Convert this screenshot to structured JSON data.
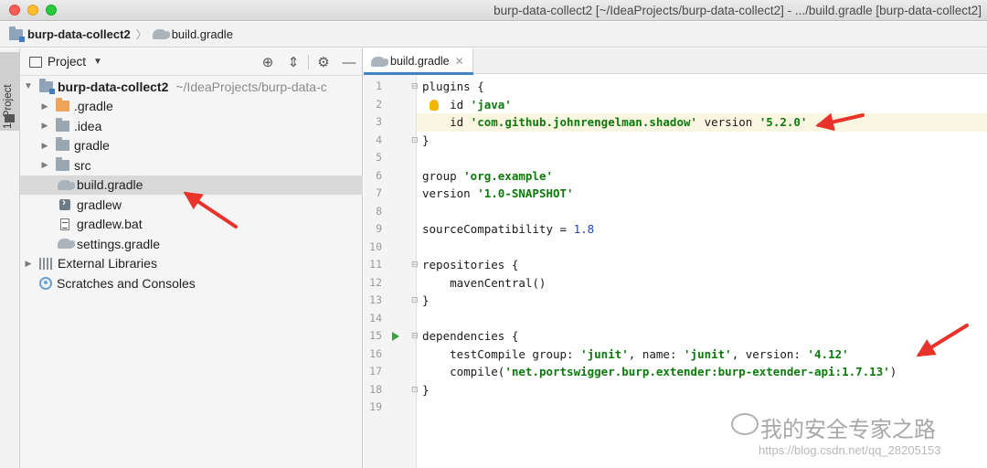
{
  "window": {
    "title": "burp-data-collect2 [~/IdeaProjects/burp-data-collect2] - .../build.gradle [burp-data-collect2]"
  },
  "breadcrumb": {
    "project": "burp-data-collect2",
    "file": "build.gradle"
  },
  "toolstrip": {
    "label": "1: Project"
  },
  "project_panel": {
    "title": "Project",
    "tools": [
      "locate-icon",
      "collapse-icon",
      "gear-icon",
      "hide-icon"
    ],
    "tree": [
      {
        "label": "burp-data-collect2",
        "path": "~/IdeaProjects/burp-data-c",
        "icon": "module-folder-icon",
        "expanded": true
      },
      {
        "label": ".gradle",
        "icon": "folder-orange-icon",
        "expanded": false
      },
      {
        "label": ".idea",
        "icon": "folder-icon",
        "expanded": false
      },
      {
        "label": "gradle",
        "icon": "folder-icon",
        "expanded": false
      },
      {
        "label": "src",
        "icon": "folder-icon",
        "expanded": false
      },
      {
        "label": "build.gradle",
        "icon": "gradle-icon",
        "selected": true
      },
      {
        "label": "gradlew",
        "icon": "executable-icon"
      },
      {
        "label": "gradlew.bat",
        "icon": "batch-file-icon"
      },
      {
        "label": "settings.gradle",
        "icon": "gradle-icon"
      },
      {
        "label": "External Libraries",
        "icon": "libraries-icon",
        "expanded": false
      },
      {
        "label": "Scratches and Consoles",
        "icon": "scratches-icon"
      }
    ]
  },
  "editor": {
    "tab_label": "build.gradle",
    "lines": [
      {
        "n": "1",
        "parts": [
          [
            "plain",
            "plugins {"
          ]
        ]
      },
      {
        "n": "2",
        "parts": [
          [
            "plain",
            "    id "
          ],
          [
            "str",
            "'java'"
          ]
        ]
      },
      {
        "n": "3",
        "parts": [
          [
            "plain",
            "    id "
          ],
          [
            "str",
            "'com.github.johnrengelman.shadow'"
          ],
          [
            "plain",
            " version "
          ],
          [
            "str",
            "'5.2.0'"
          ]
        ]
      },
      {
        "n": "4",
        "parts": [
          [
            "plain",
            "}"
          ]
        ]
      },
      {
        "n": "5",
        "parts": []
      },
      {
        "n": "6",
        "parts": [
          [
            "plain",
            "group "
          ],
          [
            "str",
            "'org.example'"
          ]
        ]
      },
      {
        "n": "7",
        "parts": [
          [
            "plain",
            "version "
          ],
          [
            "str",
            "'1.0-SNAPSHOT'"
          ]
        ]
      },
      {
        "n": "8",
        "parts": []
      },
      {
        "n": "9",
        "parts": [
          [
            "plain",
            "sourceCompatibility = "
          ],
          [
            "num",
            "1.8"
          ]
        ]
      },
      {
        "n": "10",
        "parts": []
      },
      {
        "n": "11",
        "parts": [
          [
            "plain",
            "repositories {"
          ]
        ]
      },
      {
        "n": "12",
        "parts": [
          [
            "plain",
            "    mavenCentral()"
          ]
        ]
      },
      {
        "n": "13",
        "parts": [
          [
            "plain",
            "}"
          ]
        ]
      },
      {
        "n": "14",
        "parts": []
      },
      {
        "n": "15",
        "parts": [
          [
            "plain",
            "dependencies {"
          ]
        ]
      },
      {
        "n": "16",
        "parts": [
          [
            "plain",
            "    testCompile "
          ],
          [
            "plain",
            "group: "
          ],
          [
            "str",
            "'junit'"
          ],
          [
            "plain",
            ", "
          ],
          [
            "plain",
            "name: "
          ],
          [
            "str",
            "'junit'"
          ],
          [
            "plain",
            ", "
          ],
          [
            "plain",
            "version: "
          ],
          [
            "str",
            "'4.12'"
          ]
        ]
      },
      {
        "n": "17",
        "parts": [
          [
            "plain",
            "    compile("
          ],
          [
            "str",
            "'net.portswigger.burp.extender:burp-extender-api:1.7.13'"
          ],
          [
            "plain",
            ")"
          ]
        ]
      },
      {
        "n": "18",
        "parts": [
          [
            "plain",
            "}"
          ]
        ]
      },
      {
        "n": "19",
        "parts": []
      }
    ]
  },
  "watermark": {
    "title": "我的安全专家之路",
    "url": "https://blog.csdn.net/qq_28205153"
  },
  "colors": {
    "string": "#0b7a0b",
    "number": "#1946c7",
    "annotation_arrow": "#e8322a",
    "selection": "#d9d9d9"
  }
}
